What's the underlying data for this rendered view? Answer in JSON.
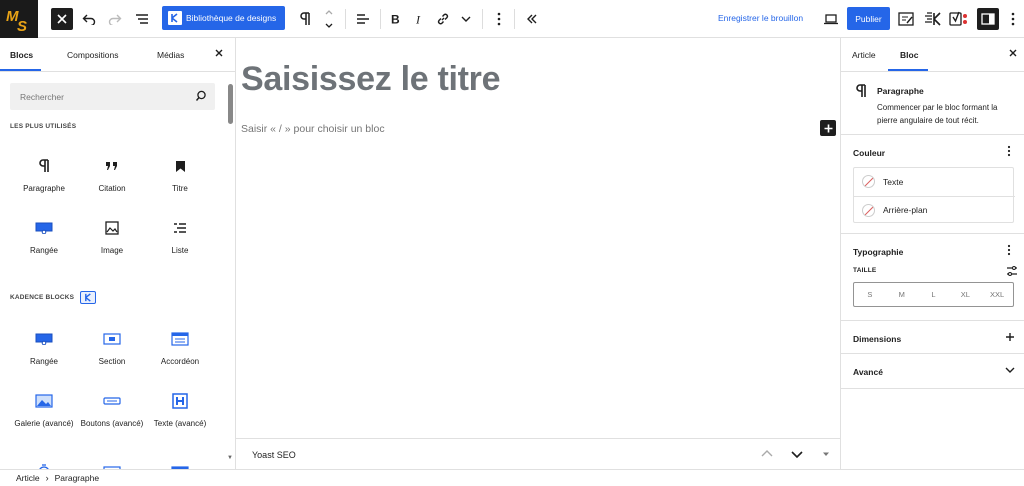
{
  "toolbar": {
    "library_label": "Bibliothèque de designs",
    "save_draft_label": "Enregistrer le brouillon",
    "publish_label": "Publier",
    "accent_color": "#2566e8"
  },
  "inserter": {
    "tabs": [
      {
        "label": "Blocs",
        "active": true
      },
      {
        "label": "Compositions",
        "active": false
      },
      {
        "label": "Médias",
        "active": false
      }
    ],
    "search_placeholder": "Rechercher",
    "most_used_heading": "LES PLUS UTILISÉS",
    "most_used": [
      {
        "label": "Paragraphe",
        "icon": "pilcrow-icon"
      },
      {
        "label": "Citation",
        "icon": "quote-icon"
      },
      {
        "label": "Titre",
        "icon": "bookmark-icon"
      },
      {
        "label": "Rangée",
        "icon": "row-icon"
      },
      {
        "label": "Image",
        "icon": "image-icon"
      },
      {
        "label": "Liste",
        "icon": "list-icon"
      }
    ],
    "kadence_heading": "KADENCE BLOCKS",
    "kadence": [
      {
        "label": "Rangée",
        "icon": "kadence-row-icon"
      },
      {
        "label": "Section",
        "icon": "kadence-section-icon"
      },
      {
        "label": "Accordéon",
        "icon": "kadence-accordion-icon"
      },
      {
        "label": "Galerie (avancé)",
        "icon": "kadence-gallery-icon"
      },
      {
        "label": "Boutons (avancé)",
        "icon": "kadence-buttons-icon"
      },
      {
        "label": "Texte (avancé)",
        "icon": "kadence-heading-icon"
      }
    ]
  },
  "editor": {
    "title_placeholder": "Saisissez le titre",
    "paragraph_placeholder": "Saisir « / » pour choisir un bloc"
  },
  "yoast": {
    "title": "Yoast SEO"
  },
  "sidebar": {
    "tabs": [
      {
        "label": "Article",
        "active": false
      },
      {
        "label": "Bloc",
        "active": true
      }
    ],
    "block_name": "Paragraphe",
    "block_description": "Commencer par le bloc formant la pierre angulaire de tout récit.",
    "color_panel": {
      "title": "Couleur",
      "options": [
        "Texte",
        "Arrière-plan"
      ]
    },
    "typography_panel": {
      "title": "Typographie",
      "size_label": "TAILLE",
      "sizes": [
        "S",
        "M",
        "L",
        "XL",
        "XXL"
      ]
    },
    "dimensions_title": "Dimensions",
    "advanced_title": "Avancé"
  },
  "breadcrumb": [
    "Article",
    "Paragraphe"
  ]
}
